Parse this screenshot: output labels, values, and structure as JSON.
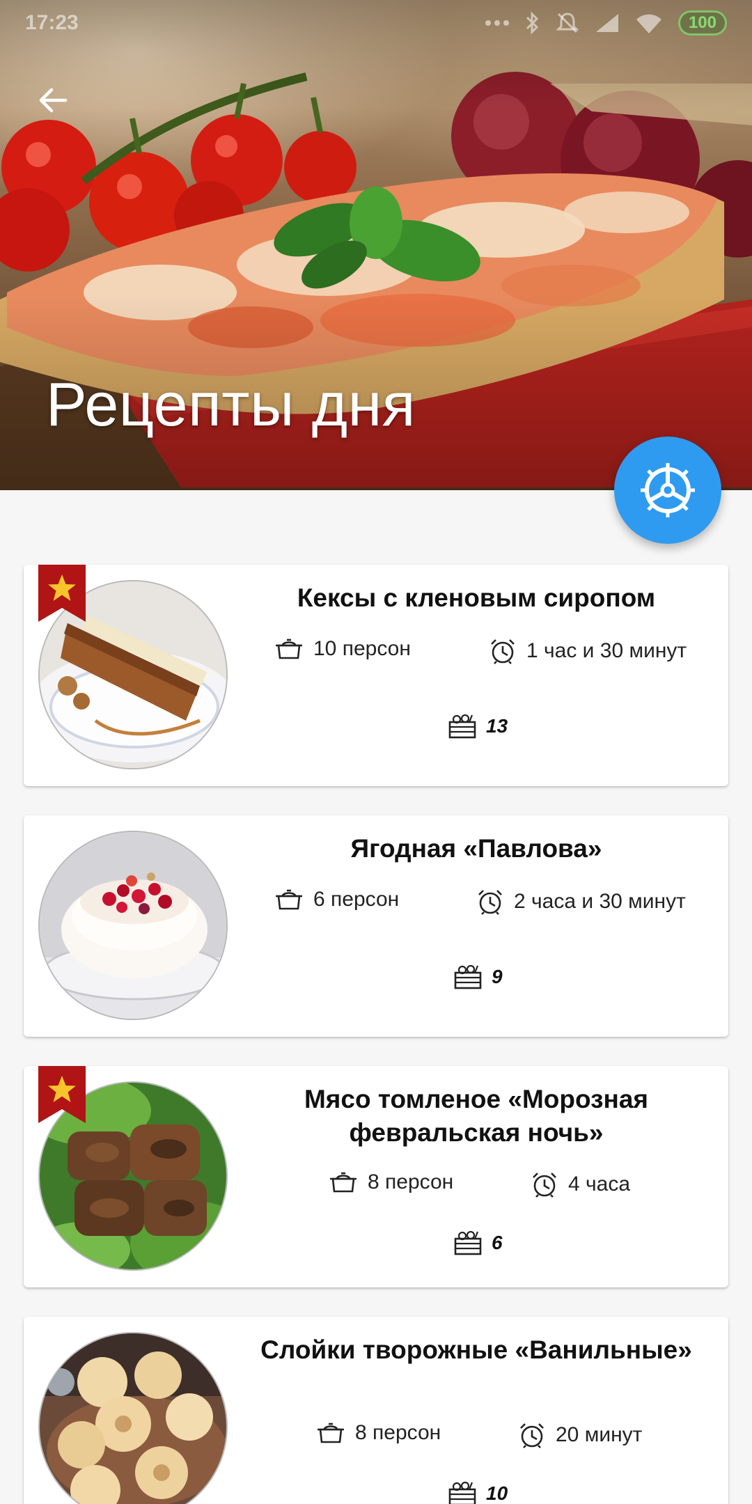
{
  "status_bar": {
    "time": "17:23",
    "battery": "100"
  },
  "header": {
    "title": "Рецепты дня",
    "back_icon": "arrow-left-icon",
    "fab_icon": "steering-wheel-icon"
  },
  "colors": {
    "accent": "#2e9bf0",
    "ribbon": "#b01414",
    "star": "#f7c52a"
  },
  "recipes": [
    {
      "title": "Кексы с кленовым сиропом",
      "favorite": true,
      "servings": "10 персон",
      "time": "1 час и 30 минут",
      "ingredients": "13"
    },
    {
      "title": "Ягодная «Павлова»",
      "favorite": false,
      "servings": "6 персон",
      "time": "2 часа и 30 минут",
      "ingredients": "9"
    },
    {
      "title": "Мясо томленое «Морозная февральская ночь»",
      "favorite": true,
      "servings": "8 персон",
      "time": "4 часа",
      "ingredients": "6"
    },
    {
      "title": "Слойки творожные «Ванильные»",
      "favorite": false,
      "servings": "8 персон",
      "time": "20 минут",
      "ingredients": "10"
    }
  ]
}
